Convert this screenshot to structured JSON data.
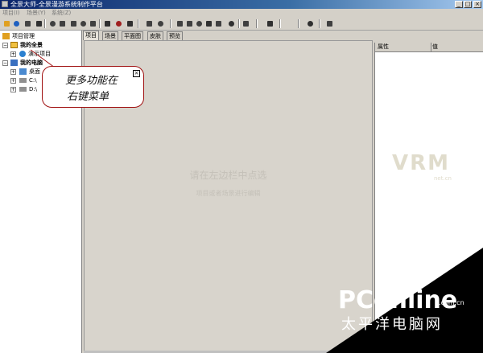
{
  "window": {
    "title": "全景大师-全景漫游系统制作平台",
    "minimize": "_",
    "maximize": "□",
    "close": "×"
  },
  "menu": [
    "项目(I)",
    "场景(Y)",
    "系统(Z)"
  ],
  "toolbar": [
    {
      "icon": "open-folder-icon",
      "color": "#e0a020"
    },
    {
      "icon": "globe-icon",
      "color": "#2060c0"
    },
    {
      "icon": "arrow-left-icon",
      "color": "#444444"
    },
    {
      "icon": "save-icon",
      "color": "#303030"
    },
    {
      "icon": "print-icon",
      "color": "#404040"
    },
    {
      "icon": "photo-icon",
      "color": "#404040"
    },
    {
      "icon": "copy-icon",
      "color": "#404040"
    },
    {
      "icon": "paste-icon",
      "color": "#404040"
    },
    {
      "icon": "refresh-icon",
      "color": "#404040"
    },
    {
      "icon": "home-icon",
      "color": "#303030"
    },
    {
      "icon": "list-icon",
      "color": "#a02020"
    },
    {
      "icon": "document-icon",
      "color": "#303030"
    },
    {
      "icon": "arrows-horizontal-icon",
      "color": "#404040"
    },
    {
      "icon": "arrows-collapse-icon",
      "color": "#404040"
    },
    {
      "icon": "camera-icon",
      "color": "#404040"
    },
    {
      "icon": "camera-add-icon",
      "color": "#404040"
    },
    {
      "icon": "camera-remove-icon",
      "color": "#404040"
    },
    {
      "icon": "hat-icon",
      "color": "#303030"
    },
    {
      "icon": "hotspot-icon",
      "color": "#404040"
    },
    {
      "icon": "circle-icon",
      "color": "#303030"
    },
    {
      "icon": "layers-icon",
      "color": "#404040"
    },
    {
      "icon": "video-icon",
      "color": "#303030"
    },
    {
      "icon": "film-icon",
      "color": "#303030"
    },
    {
      "icon": "edit-icon",
      "color": "#404040"
    }
  ],
  "tree": {
    "root": "项目管理",
    "my_panorama": "我的全景",
    "demo_project": "演示项目",
    "my_computer": "我的电脑",
    "desktop": "桌面",
    "drive_c": "C:\\",
    "drive_d": "D:\\"
  },
  "tabs": [
    "项目",
    "场景",
    "平面图",
    "皮肤",
    "预览"
  ],
  "canvas": {
    "hint": "请在左边栏中点选",
    "subhint": "项目或者场景进行编辑"
  },
  "properties": {
    "col_attr": "属性",
    "col_value": "值"
  },
  "callout": {
    "line1": "更多功能在",
    "line2": "右键菜单",
    "close": "×"
  },
  "watermarks": {
    "vrm": "VRM",
    "vrm_sub": "net.cn",
    "pconline": "PConline",
    "pconline_domain": ".com.cn",
    "pconline_cn": "太平洋电脑网"
  }
}
